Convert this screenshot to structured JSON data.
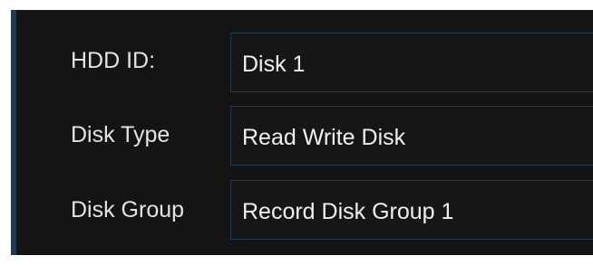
{
  "disk_settings": {
    "hdd_id": {
      "label": "HDD ID:",
      "value": "Disk 1"
    },
    "disk_type": {
      "label": "Disk Type",
      "value": "Read Write Disk"
    },
    "disk_group": {
      "label": "Disk Group",
      "value": "Record Disk Group 1"
    }
  },
  "colors": {
    "panel_background": "#141414",
    "field_border": "#243a52",
    "panel_accent_edge": "#1e3a57",
    "text": "#e3e3e3"
  }
}
